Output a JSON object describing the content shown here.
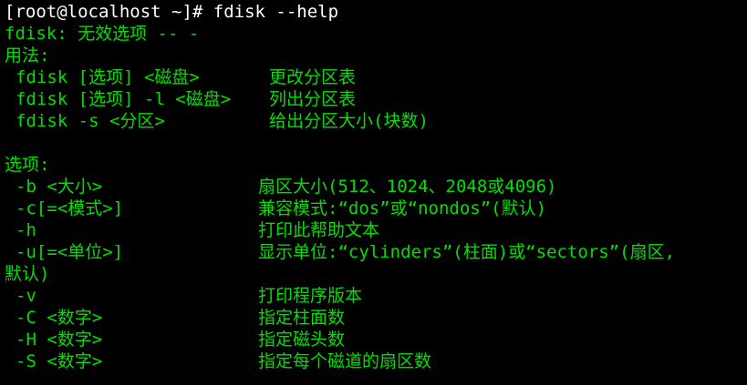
{
  "colors": {
    "background": "#000000",
    "text": "#00e000",
    "prompt": "#ffffff"
  },
  "prompt": "[root@localhost ~]# fdisk --help",
  "error_line": "fdisk: 无效选项 -- -",
  "usage_header": "用法:",
  "usage": [
    {
      "cmd": "fdisk [选项] <磁盘>",
      "desc": "更改分区表"
    },
    {
      "cmd": "fdisk [选项] -l <磁盘>",
      "desc": "列出分区表"
    },
    {
      "cmd": "fdisk -s <分区>",
      "desc": "给出分区大小(块数)"
    }
  ],
  "options_header": "选项:",
  "options": [
    {
      "flag": "-b <大小>",
      "desc": "扇区大小(512、1024、2048或4096)"
    },
    {
      "flag": "-c[=<模式>]",
      "desc": "兼容模式:“dos”或“nondos”(默认)"
    },
    {
      "flag": "-h",
      "desc": "打印此帮助文本"
    },
    {
      "flag": "-u[=<单位>]",
      "desc": "显示单位:“cylinders”(柱面)或“sectors”(扇区,"
    },
    {
      "flag": "-v",
      "desc": "打印程序版本"
    },
    {
      "flag": "-C <数字>",
      "desc": "指定柱面数"
    },
    {
      "flag": "-H <数字>",
      "desc": "指定磁头数"
    },
    {
      "flag": "-S <数字>",
      "desc": "指定每个磁道的扇区数"
    }
  ],
  "wrap_continuation": "默认)"
}
